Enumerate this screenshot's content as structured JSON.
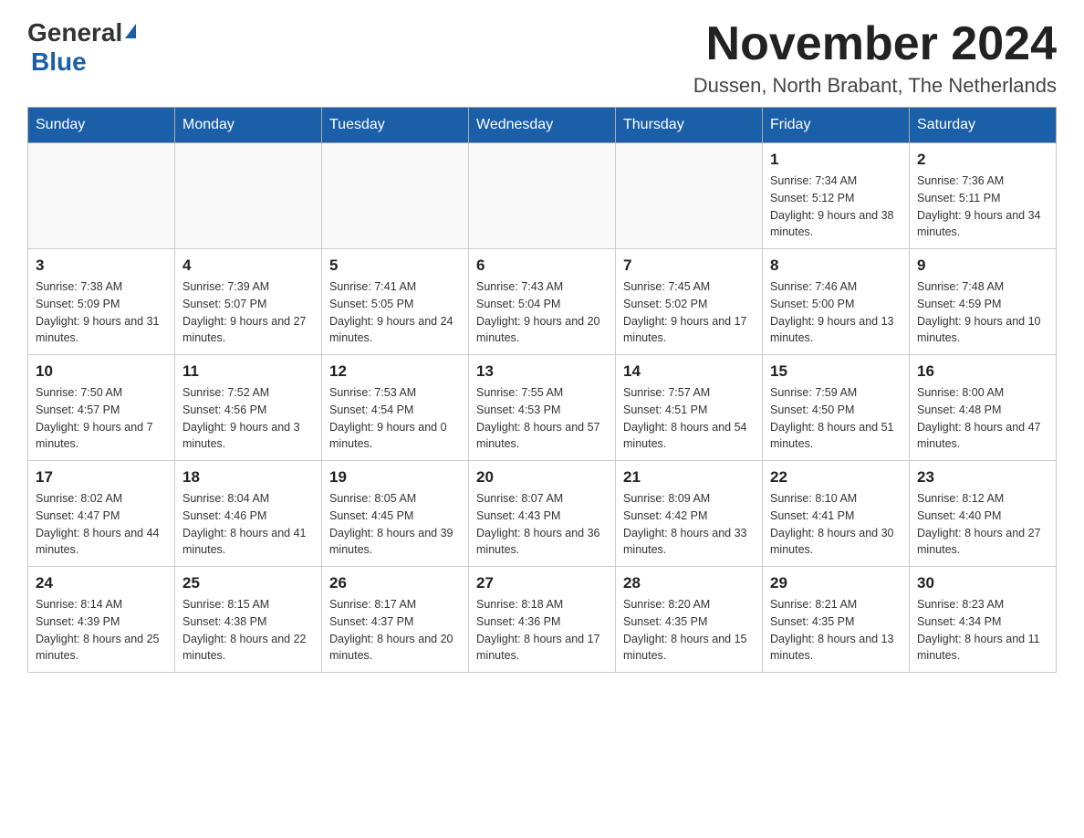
{
  "logo": {
    "general": "General",
    "blue": "Blue"
  },
  "title": "November 2024",
  "location": "Dussen, North Brabant, The Netherlands",
  "weekdays": [
    "Sunday",
    "Monday",
    "Tuesday",
    "Wednesday",
    "Thursday",
    "Friday",
    "Saturday"
  ],
  "weeks": [
    [
      {
        "day": "",
        "info": ""
      },
      {
        "day": "",
        "info": ""
      },
      {
        "day": "",
        "info": ""
      },
      {
        "day": "",
        "info": ""
      },
      {
        "day": "",
        "info": ""
      },
      {
        "day": "1",
        "info": "Sunrise: 7:34 AM\nSunset: 5:12 PM\nDaylight: 9 hours and 38 minutes."
      },
      {
        "day": "2",
        "info": "Sunrise: 7:36 AM\nSunset: 5:11 PM\nDaylight: 9 hours and 34 minutes."
      }
    ],
    [
      {
        "day": "3",
        "info": "Sunrise: 7:38 AM\nSunset: 5:09 PM\nDaylight: 9 hours and 31 minutes."
      },
      {
        "day": "4",
        "info": "Sunrise: 7:39 AM\nSunset: 5:07 PM\nDaylight: 9 hours and 27 minutes."
      },
      {
        "day": "5",
        "info": "Sunrise: 7:41 AM\nSunset: 5:05 PM\nDaylight: 9 hours and 24 minutes."
      },
      {
        "day": "6",
        "info": "Sunrise: 7:43 AM\nSunset: 5:04 PM\nDaylight: 9 hours and 20 minutes."
      },
      {
        "day": "7",
        "info": "Sunrise: 7:45 AM\nSunset: 5:02 PM\nDaylight: 9 hours and 17 minutes."
      },
      {
        "day": "8",
        "info": "Sunrise: 7:46 AM\nSunset: 5:00 PM\nDaylight: 9 hours and 13 minutes."
      },
      {
        "day": "9",
        "info": "Sunrise: 7:48 AM\nSunset: 4:59 PM\nDaylight: 9 hours and 10 minutes."
      }
    ],
    [
      {
        "day": "10",
        "info": "Sunrise: 7:50 AM\nSunset: 4:57 PM\nDaylight: 9 hours and 7 minutes."
      },
      {
        "day": "11",
        "info": "Sunrise: 7:52 AM\nSunset: 4:56 PM\nDaylight: 9 hours and 3 minutes."
      },
      {
        "day": "12",
        "info": "Sunrise: 7:53 AM\nSunset: 4:54 PM\nDaylight: 9 hours and 0 minutes."
      },
      {
        "day": "13",
        "info": "Sunrise: 7:55 AM\nSunset: 4:53 PM\nDaylight: 8 hours and 57 minutes."
      },
      {
        "day": "14",
        "info": "Sunrise: 7:57 AM\nSunset: 4:51 PM\nDaylight: 8 hours and 54 minutes."
      },
      {
        "day": "15",
        "info": "Sunrise: 7:59 AM\nSunset: 4:50 PM\nDaylight: 8 hours and 51 minutes."
      },
      {
        "day": "16",
        "info": "Sunrise: 8:00 AM\nSunset: 4:48 PM\nDaylight: 8 hours and 47 minutes."
      }
    ],
    [
      {
        "day": "17",
        "info": "Sunrise: 8:02 AM\nSunset: 4:47 PM\nDaylight: 8 hours and 44 minutes."
      },
      {
        "day": "18",
        "info": "Sunrise: 8:04 AM\nSunset: 4:46 PM\nDaylight: 8 hours and 41 minutes."
      },
      {
        "day": "19",
        "info": "Sunrise: 8:05 AM\nSunset: 4:45 PM\nDaylight: 8 hours and 39 minutes."
      },
      {
        "day": "20",
        "info": "Sunrise: 8:07 AM\nSunset: 4:43 PM\nDaylight: 8 hours and 36 minutes."
      },
      {
        "day": "21",
        "info": "Sunrise: 8:09 AM\nSunset: 4:42 PM\nDaylight: 8 hours and 33 minutes."
      },
      {
        "day": "22",
        "info": "Sunrise: 8:10 AM\nSunset: 4:41 PM\nDaylight: 8 hours and 30 minutes."
      },
      {
        "day": "23",
        "info": "Sunrise: 8:12 AM\nSunset: 4:40 PM\nDaylight: 8 hours and 27 minutes."
      }
    ],
    [
      {
        "day": "24",
        "info": "Sunrise: 8:14 AM\nSunset: 4:39 PM\nDaylight: 8 hours and 25 minutes."
      },
      {
        "day": "25",
        "info": "Sunrise: 8:15 AM\nSunset: 4:38 PM\nDaylight: 8 hours and 22 minutes."
      },
      {
        "day": "26",
        "info": "Sunrise: 8:17 AM\nSunset: 4:37 PM\nDaylight: 8 hours and 20 minutes."
      },
      {
        "day": "27",
        "info": "Sunrise: 8:18 AM\nSunset: 4:36 PM\nDaylight: 8 hours and 17 minutes."
      },
      {
        "day": "28",
        "info": "Sunrise: 8:20 AM\nSunset: 4:35 PM\nDaylight: 8 hours and 15 minutes."
      },
      {
        "day": "29",
        "info": "Sunrise: 8:21 AM\nSunset: 4:35 PM\nDaylight: 8 hours and 13 minutes."
      },
      {
        "day": "30",
        "info": "Sunrise: 8:23 AM\nSunset: 4:34 PM\nDaylight: 8 hours and 11 minutes."
      }
    ]
  ]
}
